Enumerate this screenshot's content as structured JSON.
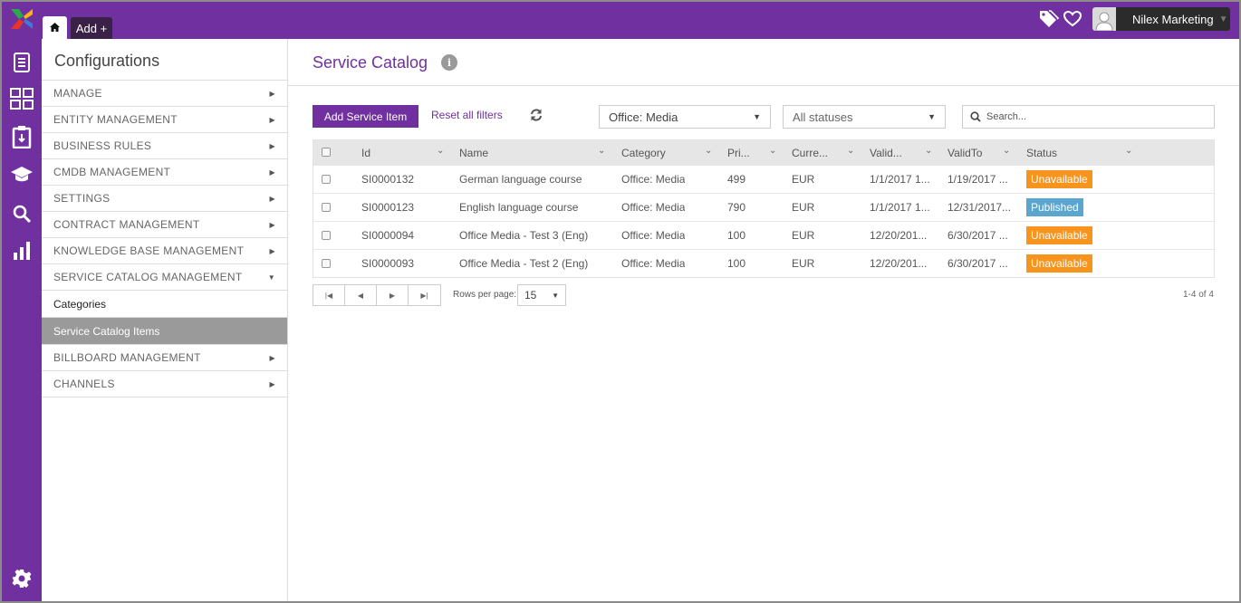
{
  "topbar": {
    "add_label": "Add +",
    "user_name": "Nilex Marketing",
    "accent_color": "#7030a0"
  },
  "rail": {
    "icons": [
      "document-icon",
      "dashboard-grid-icon",
      "clipboard-icon",
      "graduation-cap-icon",
      "search-icon",
      "bar-chart-icon",
      "gear-icon"
    ]
  },
  "config": {
    "title": "Configurations",
    "menu": [
      {
        "label": "MANAGE",
        "expanded": false
      },
      {
        "label": "ENTITY MANAGEMENT",
        "expanded": false
      },
      {
        "label": "BUSINESS RULES",
        "expanded": false
      },
      {
        "label": "CMDB MANAGEMENT",
        "expanded": false
      },
      {
        "label": "SETTINGS",
        "expanded": false
      },
      {
        "label": "CONTRACT MANAGEMENT",
        "expanded": false
      },
      {
        "label": "KNOWLEDGE BASE MANAGEMENT",
        "expanded": false
      },
      {
        "label": "SERVICE CATALOG MANAGEMENT",
        "expanded": true
      }
    ],
    "sub_items": [
      {
        "label": "Categories",
        "active": false
      },
      {
        "label": "Service Catalog Items",
        "active": true
      }
    ],
    "menu_after": [
      {
        "label": "BILLBOARD MANAGEMENT"
      },
      {
        "label": "CHANNELS"
      }
    ]
  },
  "main": {
    "title": "Service Catalog",
    "add_button": "Add Service Item",
    "reset_link": "Reset all filters",
    "category_filter": "Office: Media",
    "status_filter": "All statuses",
    "search_placeholder": "Search...",
    "columns": [
      "Id",
      "Name",
      "Category",
      "Pri...",
      "Curre...",
      "Valid...",
      "ValidTo",
      "Status"
    ],
    "rows": [
      {
        "id": "SI0000132",
        "name": "German language course",
        "category": "Office: Media",
        "price": "499",
        "currency": "EUR",
        "valid_from": "1/1/2017 1...",
        "valid_to": "1/19/2017 ...",
        "status": "Unavailable",
        "status_color": "#f7941d"
      },
      {
        "id": "SI0000123",
        "name": "English language course",
        "category": "Office: Media",
        "price": "790",
        "currency": "EUR",
        "valid_from": "1/1/2017 1...",
        "valid_to": "12/31/2017...",
        "status": "Published",
        "status_color": "#5aa6cf"
      },
      {
        "id": "SI0000094",
        "name": "Office Media - Test 3 (Eng)",
        "category": "Office: Media",
        "price": "100",
        "currency": "EUR",
        "valid_from": "12/20/201...",
        "valid_to": "6/30/2017 ...",
        "status": "Unavailable",
        "status_color": "#f7941d"
      },
      {
        "id": "SI0000093",
        "name": "Office Media - Test 2 (Eng)",
        "category": "Office: Media",
        "price": "100",
        "currency": "EUR",
        "valid_from": "12/20/201...",
        "valid_to": "6/30/2017 ...",
        "status": "Unavailable",
        "status_color": "#f7941d"
      }
    ],
    "rows_per_page_label": "Rows per page:",
    "rows_per_page": "15",
    "page_count": "1-4 of 4"
  }
}
